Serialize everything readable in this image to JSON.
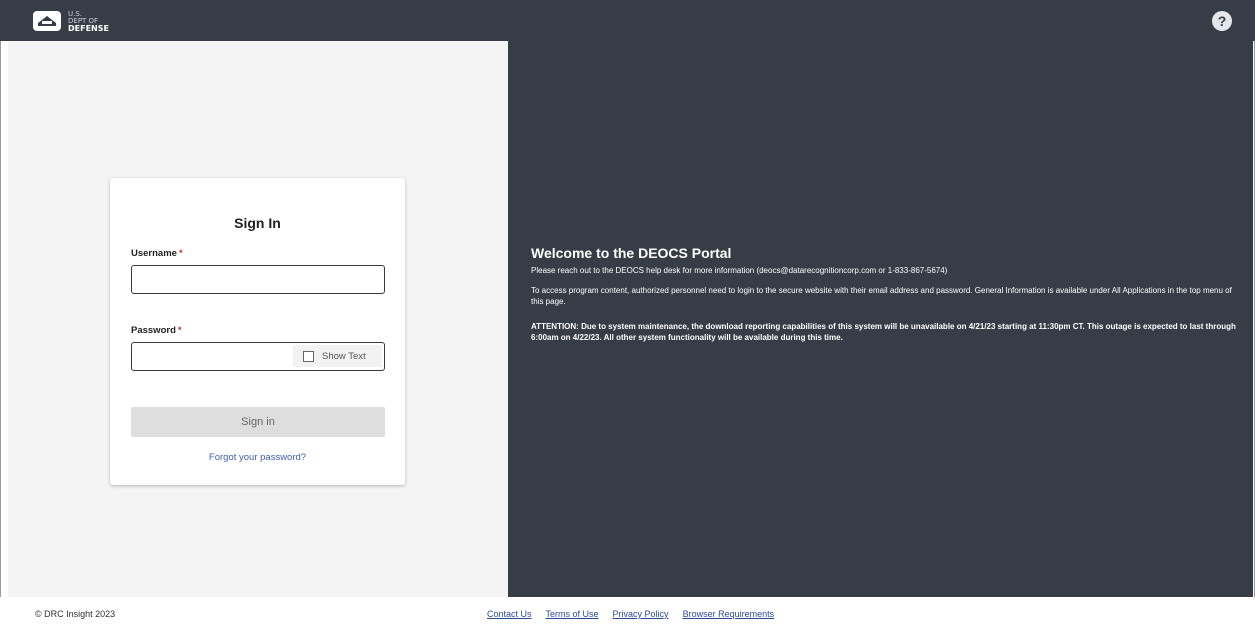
{
  "header": {
    "logo": {
      "line1": "U.S.",
      "line2": "DEPT OF",
      "line3": "DEFENSE"
    },
    "help_label": "?"
  },
  "signin": {
    "title": "Sign In",
    "username_label": "Username",
    "password_label": "Password",
    "required_mark": "*",
    "username_value": "",
    "password_value": "",
    "show_text_label": "Show Text",
    "show_text_checked": false,
    "submit_label": "Sign in",
    "forgot_label": "Forgot your password?"
  },
  "welcome": {
    "title": "Welcome to the DEOCS Portal",
    "help_text": "Please reach out to the DEOCS help desk for more information (deocs@datarecognitioncorp.com or 1-833-867-5674)",
    "access_text": "To access program content, authorized personnel need to login to the secure website with their email address and password. General Information is available under All Applications in the top menu of this page.",
    "attention_text": "ATTENTION: Due to system maintenance, the download reporting capabilities of this system will be unavailable on 4/21/23 starting at 11:30pm CT. This outage is expected to last through 6:00am on 4/22/23. All other system functionality will be available during this time."
  },
  "footer": {
    "copyright": "© DRC Insight 2023",
    "links": [
      "Contact Us",
      "Terms of Use",
      "Privacy Policy",
      "Browser Requirements"
    ]
  },
  "colors": {
    "header_bg": "#363d47",
    "panel_bg": "#363d47",
    "left_bg": "#f4f4f4",
    "link": "#2b4a9a",
    "required": "#c0392b"
  },
  "icons": {
    "logo": "pentagon-seal-icon",
    "help": "question-circle-icon",
    "checkbox": "checkbox-icon"
  }
}
